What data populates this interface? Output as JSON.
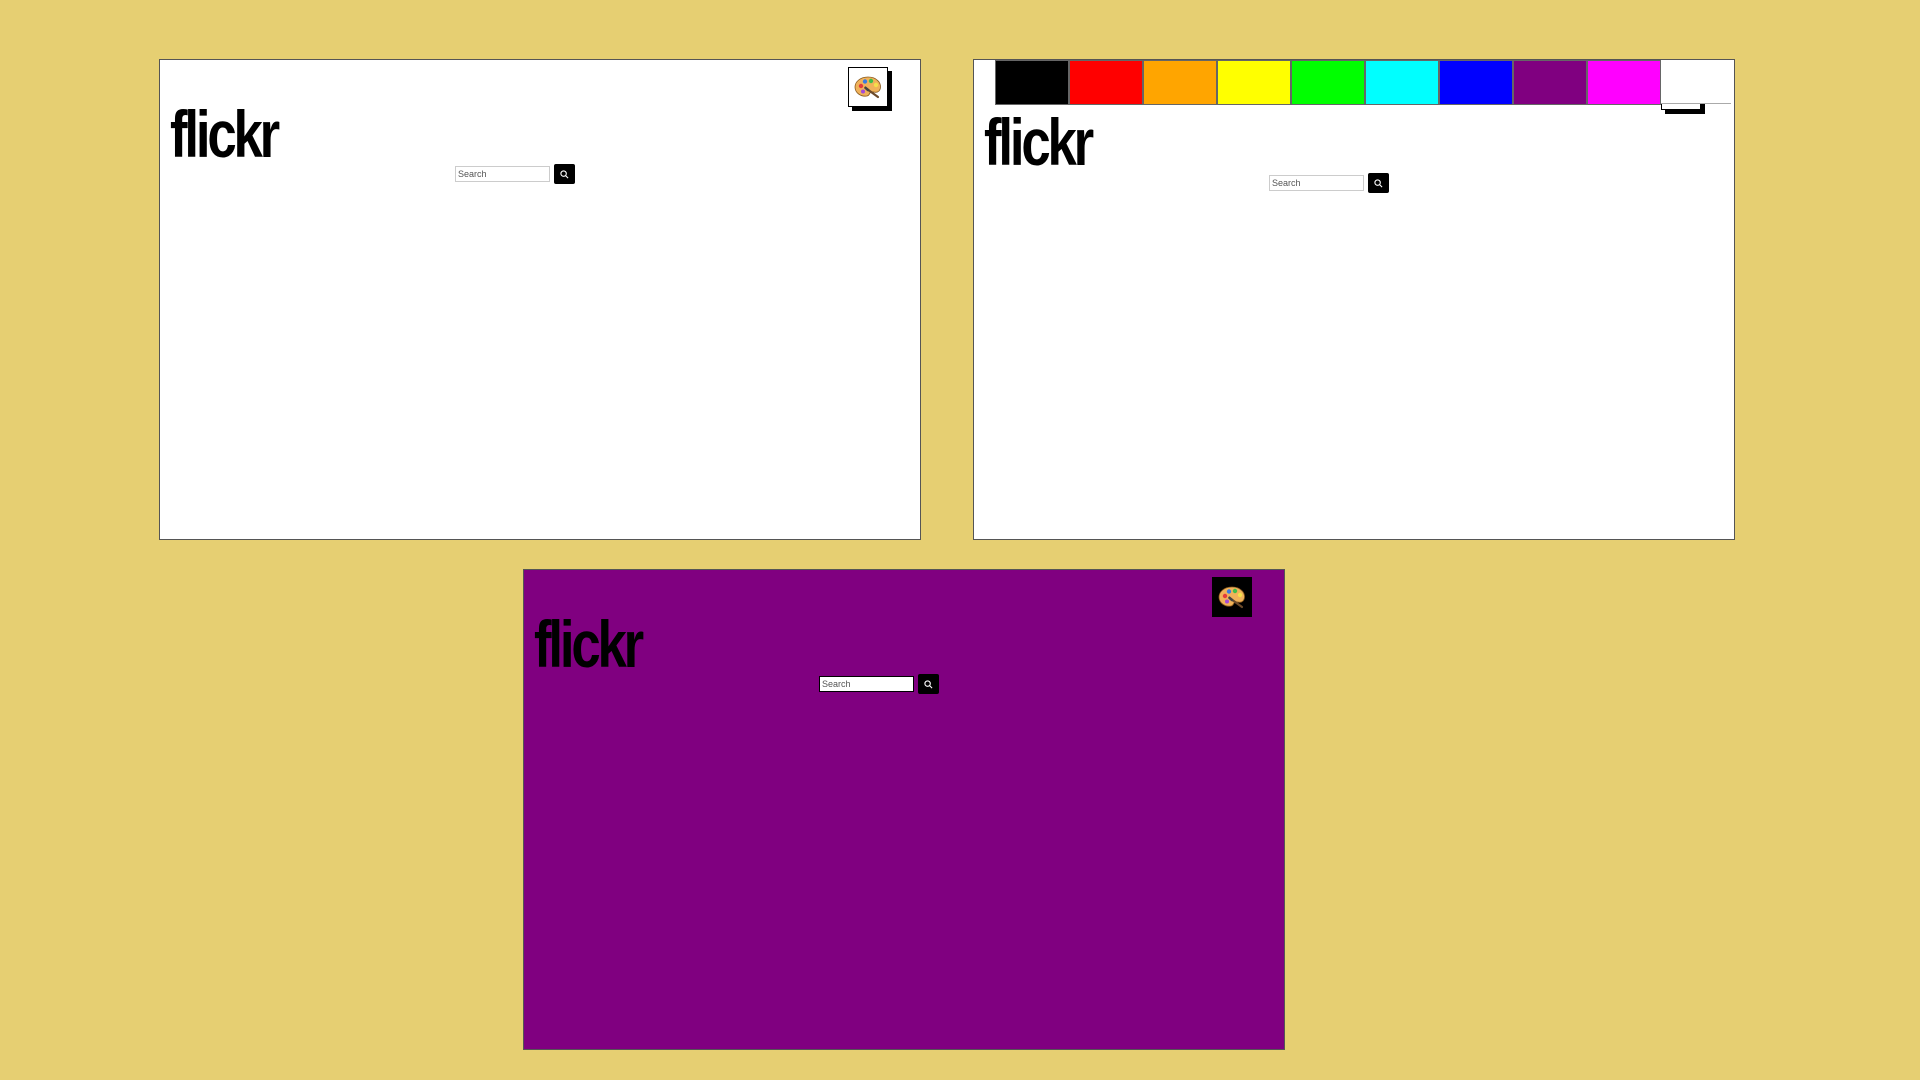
{
  "panels": [
    {
      "id": "default-theme",
      "background": "#ffffff",
      "logo": "flickr",
      "search_placeholder": "Search",
      "palette_open": false
    },
    {
      "id": "palette-open",
      "background": "#ffffff",
      "logo": "flickr",
      "search_placeholder": "Search",
      "palette_open": true,
      "swatches": [
        "#000000",
        "#ff0000",
        "#ffa500",
        "#ffff00",
        "#00ff00",
        "#00ffff",
        "#0000ff",
        "#800080",
        "#ff00ff"
      ]
    },
    {
      "id": "purple-theme",
      "background": "#800080",
      "logo": "flickr",
      "search_placeholder": "Search",
      "palette_open": false
    }
  ],
  "page_background": "#e6cf72",
  "icons": {
    "search": "search-icon",
    "palette": "palette-icon"
  }
}
